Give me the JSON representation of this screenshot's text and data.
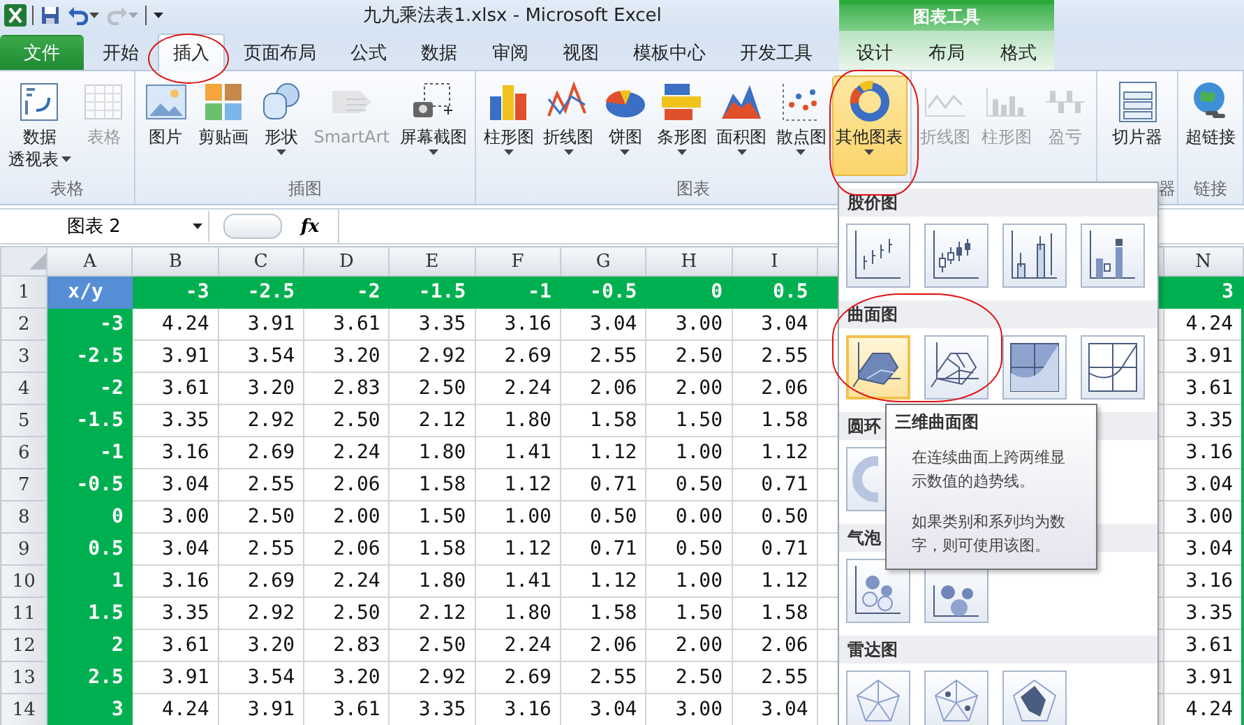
{
  "window": {
    "title": "九九乘法表1.xlsx  -  Microsoft Excel",
    "context_group": "图表工具"
  },
  "quick_access": [
    {
      "kind": "save",
      "disabled": false
    },
    {
      "kind": "undo",
      "disabled": false
    },
    {
      "kind": "redo",
      "disabled": true
    }
  ],
  "tabs": [
    {
      "label": "文件",
      "kind": "file",
      "selected": false
    },
    {
      "label": "开始",
      "kind": "normal",
      "selected": false
    },
    {
      "label": "插入",
      "kind": "normal",
      "selected": true
    },
    {
      "label": "页面布局",
      "kind": "normal",
      "selected": false
    },
    {
      "label": "公式",
      "kind": "normal",
      "selected": false
    },
    {
      "label": "数据",
      "kind": "normal",
      "selected": false
    },
    {
      "label": "审阅",
      "kind": "normal",
      "selected": false
    },
    {
      "label": "视图",
      "kind": "normal",
      "selected": false
    },
    {
      "label": "模板中心",
      "kind": "normal",
      "selected": false
    },
    {
      "label": "开发工具",
      "kind": "normal",
      "selected": false
    },
    {
      "label": "设计",
      "kind": "context",
      "selected": false
    },
    {
      "label": "布局",
      "kind": "context",
      "selected": false
    },
    {
      "label": "格式",
      "kind": "context",
      "selected": false
    }
  ],
  "ribbon": {
    "groups": [
      {
        "label": "表格",
        "items": [
          {
            "kind": "pivot",
            "lines": [
              "数据",
              "透视表"
            ],
            "menu": true,
            "disabled": false,
            "selected": false
          },
          {
            "kind": "table",
            "lines": [
              "表格"
            ],
            "menu": false,
            "disabled": true,
            "selected": false
          }
        ]
      },
      {
        "label": "插图",
        "items": [
          {
            "kind": "picture",
            "lines": [
              "图片"
            ],
            "menu": false,
            "disabled": false,
            "selected": false
          },
          {
            "kind": "clipart",
            "lines": [
              "剪贴画"
            ],
            "menu": false,
            "disabled": false,
            "selected": false
          },
          {
            "kind": "shapes",
            "lines": [
              "形状"
            ],
            "menu": true,
            "disabled": false,
            "selected": false
          },
          {
            "kind": "smartart",
            "lines": [
              "SmartArt"
            ],
            "menu": false,
            "disabled": true,
            "selected": false
          },
          {
            "kind": "screenshot",
            "lines": [
              "屏幕截图"
            ],
            "menu": true,
            "disabled": false,
            "selected": false
          }
        ]
      },
      {
        "label": "图表",
        "items": [
          {
            "kind": "column",
            "lines": [
              "柱形图"
            ],
            "menu": true,
            "disabled": false,
            "selected": false
          },
          {
            "kind": "line",
            "lines": [
              "折线图"
            ],
            "menu": true,
            "disabled": false,
            "selected": false
          },
          {
            "kind": "pie",
            "lines": [
              "饼图"
            ],
            "menu": true,
            "disabled": false,
            "selected": false
          },
          {
            "kind": "bar",
            "lines": [
              "条形图"
            ],
            "menu": true,
            "disabled": false,
            "selected": false
          },
          {
            "kind": "area",
            "lines": [
              "面积图"
            ],
            "menu": true,
            "disabled": false,
            "selected": false
          },
          {
            "kind": "scatter",
            "lines": [
              "散点图"
            ],
            "menu": true,
            "disabled": false,
            "selected": false
          },
          {
            "kind": "other",
            "lines": [
              "其他图表"
            ],
            "menu": true,
            "disabled": false,
            "selected": true
          }
        ]
      },
      {
        "items": [
          {
            "kind": "spark-line",
            "lines": [
              "折线图"
            ],
            "menu": false,
            "disabled": true,
            "selected": false
          },
          {
            "kind": "spark-column",
            "lines": [
              "柱形图"
            ],
            "menu": false,
            "disabled": true,
            "selected": false
          },
          {
            "kind": "winloss",
            "lines": [
              "盈亏"
            ],
            "menu": false,
            "disabled": true,
            "selected": false
          }
        ]
      },
      {
        "label": "器",
        "items": [
          {
            "kind": "slicer",
            "lines": [
              "切片器"
            ],
            "menu": false,
            "disabled": false,
            "selected": false
          }
        ]
      },
      {
        "label": "链接",
        "items": [
          {
            "kind": "link",
            "lines": [
              "超链接"
            ],
            "menu": false,
            "disabled": false,
            "selected": false
          }
        ]
      }
    ]
  },
  "formula_bar": {
    "name_box": "图表 2",
    "fx": "fx"
  },
  "sheet": {
    "columns": [
      "A",
      "B",
      "C",
      "D",
      "E",
      "F",
      "G",
      "H",
      "I",
      "N"
    ],
    "rows": [
      {
        "number": "1",
        "cells": [
          "x/y",
          "-3",
          "-2.5",
          "-2",
          "-1.5",
          "-1",
          "-0.5",
          "0",
          "0.5",
          "3"
        ]
      },
      {
        "number": "2",
        "cells": [
          "-3",
          "4.24",
          "3.91",
          "3.61",
          "3.35",
          "3.16",
          "3.04",
          "3.00",
          "3.04",
          "4.24"
        ]
      },
      {
        "number": "3",
        "cells": [
          "-2.5",
          "3.91",
          "3.54",
          "3.20",
          "2.92",
          "2.69",
          "2.55",
          "2.50",
          "2.55",
          "3.91"
        ]
      },
      {
        "number": "4",
        "cells": [
          "-2",
          "3.61",
          "3.20",
          "2.83",
          "2.50",
          "2.24",
          "2.06",
          "2.00",
          "2.06",
          "3.61"
        ]
      },
      {
        "number": "5",
        "cells": [
          "-1.5",
          "3.35",
          "2.92",
          "2.50",
          "2.12",
          "1.80",
          "1.58",
          "1.50",
          "1.58",
          "3.35"
        ]
      },
      {
        "number": "6",
        "cells": [
          "-1",
          "3.16",
          "2.69",
          "2.24",
          "1.80",
          "1.41",
          "1.12",
          "1.00",
          "1.12",
          "3.16"
        ]
      },
      {
        "number": "7",
        "cells": [
          "-0.5",
          "3.04",
          "2.55",
          "2.06",
          "1.58",
          "1.12",
          "0.71",
          "0.50",
          "0.71",
          "3.04"
        ]
      },
      {
        "number": "8",
        "cells": [
          "0",
          "3.00",
          "2.50",
          "2.00",
          "1.50",
          "1.00",
          "0.50",
          "0.00",
          "0.50",
          "3.00"
        ]
      },
      {
        "number": "9",
        "cells": [
          "0.5",
          "3.04",
          "2.55",
          "2.06",
          "1.58",
          "1.12",
          "0.71",
          "0.50",
          "0.71",
          "3.04"
        ]
      },
      {
        "number": "10",
        "cells": [
          "1",
          "3.16",
          "2.69",
          "2.24",
          "1.80",
          "1.41",
          "1.12",
          "1.00",
          "1.12",
          "3.16"
        ]
      },
      {
        "number": "11",
        "cells": [
          "1.5",
          "3.35",
          "2.92",
          "2.50",
          "2.12",
          "1.80",
          "1.58",
          "1.50",
          "1.58",
          "3.35"
        ]
      },
      {
        "number": "12",
        "cells": [
          "2",
          "3.61",
          "3.20",
          "2.83",
          "2.50",
          "2.24",
          "2.06",
          "2.00",
          "2.06",
          "3.61"
        ]
      },
      {
        "number": "13",
        "cells": [
          "2.5",
          "3.91",
          "3.54",
          "3.20",
          "2.92",
          "2.69",
          "2.55",
          "2.50",
          "2.55",
          "3.91"
        ]
      },
      {
        "number": "14",
        "cells": [
          "3",
          "4.24",
          "3.91",
          "3.61",
          "3.35",
          "3.16",
          "3.04",
          "3.00",
          "3.04",
          "4.24"
        ]
      }
    ]
  },
  "chart_menu": {
    "sections": [
      {
        "title": "股价图",
        "items": [
          {
            "kind": "stock-hlc",
            "selected": false
          },
          {
            "kind": "stock-ohlc",
            "selected": false
          },
          {
            "kind": "stock-vhlc",
            "selected": false
          },
          {
            "kind": "stock-vohlc",
            "selected": false
          }
        ]
      },
      {
        "title": "曲面图",
        "items": [
          {
            "kind": "surface-3d",
            "selected": true
          },
          {
            "kind": "surface-wire",
            "selected": false
          },
          {
            "kind": "contour",
            "selected": false
          },
          {
            "kind": "contour-wire",
            "selected": false
          }
        ]
      },
      {
        "title": "圆环",
        "items": [
          {
            "kind": "doughnut",
            "selected": false
          }
        ]
      },
      {
        "title": "气泡",
        "items": [
          {
            "kind": "bubble",
            "selected": false
          },
          {
            "kind": "bubble-3d",
            "selected": false
          }
        ]
      },
      {
        "title": "雷达图",
        "items": [
          {
            "kind": "radar",
            "selected": false
          },
          {
            "kind": "radar-markers",
            "selected": false
          },
          {
            "kind": "radar-filled",
            "selected": false
          }
        ]
      }
    ],
    "tooltip": {
      "title": "三维曲面图",
      "paragraphs": [
        "在连续曲面上跨两维显示数值的趋势线。",
        "如果类别和系列均为数字，则可使用该图。"
      ]
    }
  }
}
